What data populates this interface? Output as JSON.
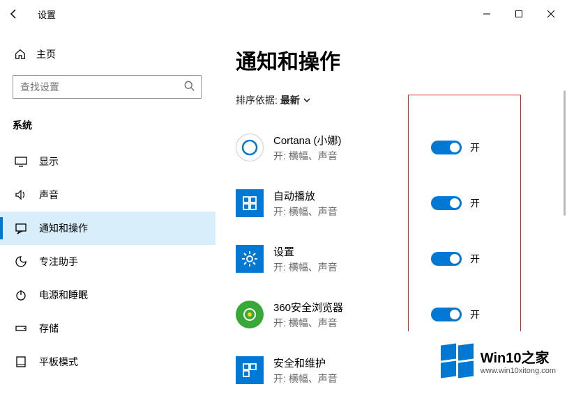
{
  "window": {
    "title": "设置",
    "home_label": "主页",
    "search_placeholder": "查找设置",
    "group_label": "系统"
  },
  "nav": [
    {
      "icon": "display-icon",
      "label": "显示"
    },
    {
      "icon": "sound-icon",
      "label": "声音"
    },
    {
      "icon": "notifications-icon",
      "label": "通知和操作",
      "selected": true
    },
    {
      "icon": "focus-assist-icon",
      "label": "专注助手"
    },
    {
      "icon": "power-icon",
      "label": "电源和睡眠"
    },
    {
      "icon": "storage-icon",
      "label": "存储"
    },
    {
      "icon": "tablet-mode-icon",
      "label": "平板模式"
    }
  ],
  "main": {
    "heading": "通知和操作",
    "sort_label": "排序依据:",
    "sort_value": "最新",
    "toggle_on_label": "开",
    "apps": [
      {
        "name": "Cortana (小娜)",
        "sub": "开: 横幅、声音",
        "icon": "cortana",
        "state": "on"
      },
      {
        "name": "自动播放",
        "sub": "开: 横幅、声音",
        "icon": "autoplay",
        "state": "on"
      },
      {
        "name": "设置",
        "sub": "开: 横幅、声音",
        "icon": "settings",
        "state": "on"
      },
      {
        "name": "360安全浏览器",
        "sub": "开: 横幅、声音",
        "icon": "browser360",
        "state": "on"
      },
      {
        "name": "安全和维护",
        "sub": "开: 横幅、声音",
        "icon": "security",
        "state": "on"
      }
    ]
  },
  "watermark": {
    "line1": "Win10之家",
    "line2": "www.win10xitong.com"
  }
}
